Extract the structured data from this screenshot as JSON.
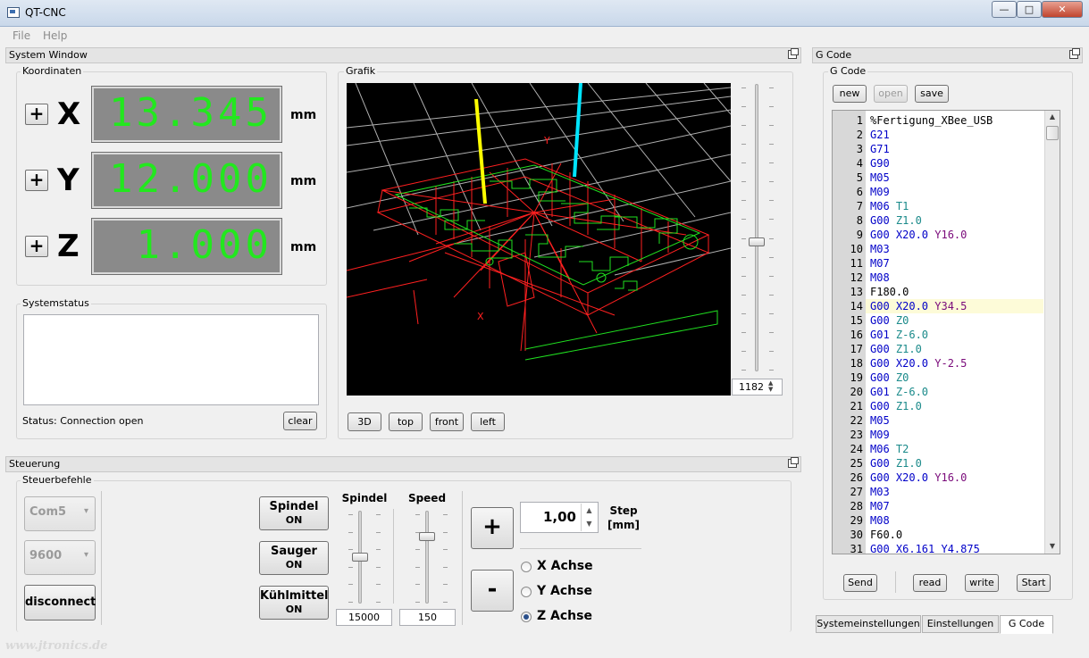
{
  "window": {
    "title": "QT-CNC",
    "minimize": "—",
    "maximize": "□",
    "close": "✕"
  },
  "menu": {
    "file": "File",
    "help": "Help"
  },
  "system_window": {
    "title": "System Window",
    "koordinaten": {
      "title": "Koordinaten",
      "axes": [
        {
          "plus": "+",
          "label": "X",
          "value": "13.345",
          "unit": "mm"
        },
        {
          "plus": "+",
          "label": "Y",
          "value": "12.000",
          "unit": "mm"
        },
        {
          "plus": "+",
          "label": "Z",
          "value": "1.000",
          "unit": "mm"
        }
      ]
    },
    "systemstatus": {
      "title": "Systemstatus",
      "status": "Status: Connection open",
      "clear": "clear"
    },
    "grafik": {
      "title": "Grafik",
      "zoom_value": "1182",
      "zoom_level": 0.45,
      "view_buttons": [
        "3D",
        "top",
        "front",
        "left"
      ],
      "axis_x": "X",
      "axis_y": "Y"
    }
  },
  "steuerung": {
    "title": "Steuerung",
    "steuerbefehle": "Steuerbefehle",
    "port": "Com5",
    "baud": "9600",
    "disconnect": "disconnect",
    "toggles": [
      {
        "label": "Spindel",
        "state": "ON"
      },
      {
        "label": "Sauger",
        "state": "ON"
      },
      {
        "label": "Kühlmittel",
        "state": "ON"
      }
    ],
    "spindel": {
      "label": "Spindel",
      "value": "15000",
      "level": 0.5
    },
    "speed": {
      "label": "Speed",
      "value": "150",
      "level": 0.75
    },
    "plus": "+",
    "minus": "-",
    "step_value": "1,00",
    "step_label": "Step",
    "step_unit": "[mm]",
    "axes": [
      {
        "label": "X Achse",
        "checked": false
      },
      {
        "label": "Y Achse",
        "checked": false
      },
      {
        "label": "Z Achse",
        "checked": true
      }
    ]
  },
  "gcode": {
    "dock_title": "G Code",
    "group_title": "G Code",
    "buttons": {
      "new": "new",
      "open": "open",
      "save": "save"
    },
    "lines": [
      {
        "n": "1",
        "t": [
          [
            "b",
            "%Fertigung_XBee_USB"
          ]
        ]
      },
      {
        "n": "2",
        "t": [
          [
            "g",
            "G21"
          ]
        ]
      },
      {
        "n": "3",
        "t": [
          [
            "g",
            "G71"
          ]
        ]
      },
      {
        "n": "4",
        "t": [
          [
            "g",
            "G90"
          ]
        ]
      },
      {
        "n": "5",
        "t": [
          [
            "g",
            "M05"
          ]
        ]
      },
      {
        "n": "6",
        "t": [
          [
            "g",
            "M09"
          ]
        ]
      },
      {
        "n": "7",
        "t": [
          [
            "g",
            "M06 "
          ],
          [
            "n",
            "T1"
          ]
        ]
      },
      {
        "n": "8",
        "t": [
          [
            "g",
            "G00 "
          ],
          [
            "n",
            "Z1.0"
          ]
        ]
      },
      {
        "n": "9",
        "t": [
          [
            "g",
            "G00 X20.0 "
          ],
          [
            "p",
            "Y16.0"
          ]
        ]
      },
      {
        "n": "10",
        "t": [
          [
            "g",
            "M03"
          ]
        ]
      },
      {
        "n": "11",
        "t": [
          [
            "g",
            "M07"
          ]
        ]
      },
      {
        "n": "12",
        "t": [
          [
            "g",
            "M08"
          ]
        ]
      },
      {
        "n": "13",
        "t": [
          [
            "b",
            "F180.0"
          ]
        ]
      },
      {
        "n": "14",
        "t": [
          [
            "g",
            "G00 X20.0 "
          ],
          [
            "p",
            "Y34.5"
          ]
        ],
        "hl": true
      },
      {
        "n": "15",
        "t": [
          [
            "g",
            "G00 "
          ],
          [
            "n",
            "Z0"
          ]
        ]
      },
      {
        "n": "16",
        "t": [
          [
            "g",
            "G01 "
          ],
          [
            "n",
            "Z-6.0"
          ]
        ]
      },
      {
        "n": "17",
        "t": [
          [
            "g",
            "G00 "
          ],
          [
            "n",
            "Z1.0"
          ]
        ]
      },
      {
        "n": "18",
        "t": [
          [
            "g",
            "G00 X20.0 "
          ],
          [
            "p",
            "Y-2.5"
          ]
        ]
      },
      {
        "n": "19",
        "t": [
          [
            "g",
            "G00 "
          ],
          [
            "n",
            "Z0"
          ]
        ]
      },
      {
        "n": "20",
        "t": [
          [
            "g",
            "G01 "
          ],
          [
            "n",
            "Z-6.0"
          ]
        ]
      },
      {
        "n": "21",
        "t": [
          [
            "g",
            "G00 "
          ],
          [
            "n",
            "Z1.0"
          ]
        ]
      },
      {
        "n": "22",
        "t": [
          [
            "g",
            "M05"
          ]
        ]
      },
      {
        "n": "23",
        "t": [
          [
            "g",
            "M09"
          ]
        ]
      },
      {
        "n": "24",
        "t": [
          [
            "g",
            "M06 "
          ],
          [
            "n",
            "T2"
          ]
        ]
      },
      {
        "n": "25",
        "t": [
          [
            "g",
            "G00 "
          ],
          [
            "n",
            "Z1.0"
          ]
        ]
      },
      {
        "n": "26",
        "t": [
          [
            "g",
            "G00 X20.0 "
          ],
          [
            "p",
            "Y16.0"
          ]
        ]
      },
      {
        "n": "27",
        "t": [
          [
            "g",
            "M03"
          ]
        ]
      },
      {
        "n": "28",
        "t": [
          [
            "g",
            "M07"
          ]
        ]
      },
      {
        "n": "29",
        "t": [
          [
            "g",
            "M08"
          ]
        ]
      },
      {
        "n": "30",
        "t": [
          [
            "b",
            "F60.0"
          ]
        ]
      },
      {
        "n": "31",
        "t": [
          [
            "g",
            "G00 X6.161 Y4.875"
          ]
        ]
      }
    ],
    "actions": {
      "send": "Send",
      "read": "read",
      "write": "write",
      "start": "Start"
    }
  },
  "tabs": [
    "Systemeinstellungen",
    "Einstellungen",
    "G Code"
  ],
  "active_tab": "G Code",
  "watermark": "www.jtronics.de",
  "colors": {
    "lcd_text": "#22e81e",
    "lcd_bg": "#8a8a8a",
    "grafik_bg": "#000000",
    "tool_yellow": "#ffff00",
    "tool_cyan": "#00e5ff"
  }
}
